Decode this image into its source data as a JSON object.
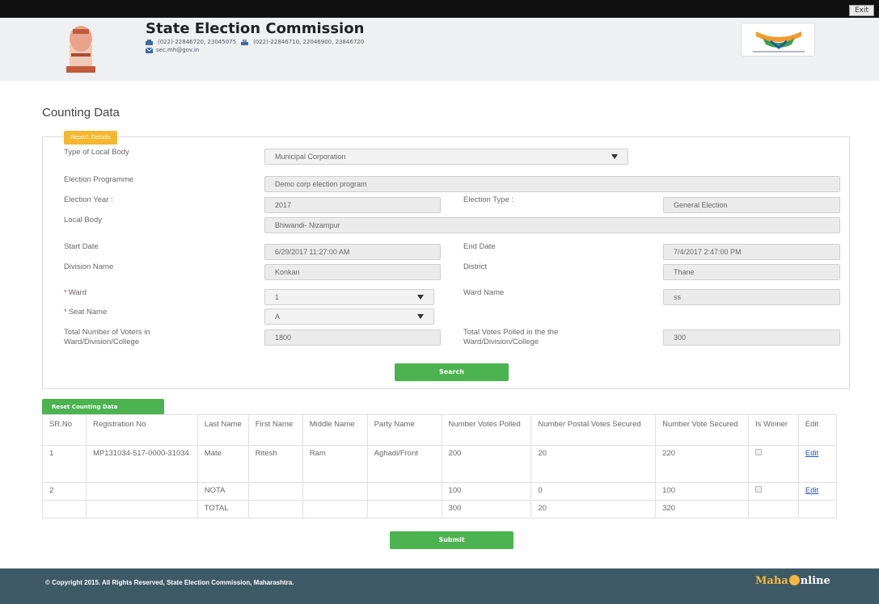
{
  "topbar": {
    "exit_label": "Exit"
  },
  "header": {
    "title": "State Election Commission",
    "phone": "(022)-22846720, 23045075",
    "fax": "(022)-22846710, 22046900, 23846720",
    "email": "sec.mh@gov.in"
  },
  "page": {
    "title": "Counting Data"
  },
  "report": {
    "badge": "Report Details",
    "type_label": "Type of Local Body",
    "type_value": "Municipal Corporation",
    "programme_label": "Election Programme",
    "programme_value": "Demo corp election program",
    "year_label": "Election Year :",
    "year_value": "2017",
    "etype_label": "Election Type :",
    "etype_value": "General Election",
    "body_label": "Local Body",
    "body_value": "Bhiwandi- Nizampur",
    "start_label": "Start Date",
    "start_value": "6/29/2017 11:27:00 AM",
    "end_label": "End Date",
    "end_value": "7/4/2017 2:47:00 PM",
    "division_label": "Division Name",
    "division_value": "Konkan",
    "district_label": "District",
    "district_value": "Thane",
    "ward_label": "Ward",
    "ward_value": "1",
    "wardname_label": "Ward Name",
    "wardname_value": "ss",
    "seat_label": "Seat Name",
    "seat_value": "A",
    "voters_label": "Total Number of Voters in Ward/Division/College",
    "voters_value": "1800",
    "polled_label": "Total Votes Polled in the the Ward/Division/College",
    "polled_value": "300",
    "search_label": "Search"
  },
  "table": {
    "reset_label": "Reset Counting Data",
    "headers": [
      "SR.No",
      "Registration No",
      "Last Name",
      "First Name",
      "Middle Name",
      "Party Name",
      "Number Votes Polled",
      "Number Postal Votes Secured",
      "Number Vote Secured",
      "Is Winner",
      "Edit"
    ],
    "rows": [
      [
        "1",
        "MP131034-517-0000-31034",
        "Mate",
        "Ritesh",
        "Ram",
        "Aghadi/Front",
        "200",
        "20",
        "220",
        "",
        "Edit"
      ],
      [
        "2",
        "",
        "NOTA",
        "",
        "",
        "",
        "100",
        "0",
        "100",
        "",
        "Edit"
      ],
      [
        "",
        "",
        "TOTAL",
        "",
        "",
        "",
        "300",
        "20",
        "320",
        "",
        ""
      ]
    ],
    "submit_label": "Submit"
  },
  "footer": {
    "copyright": "© Copyright 2015. All Rights Reserved, State Election Commission, Maharashtra.",
    "brand_left": "Maha",
    "brand_right": "nline"
  },
  "colors": {
    "accent_green": "#4bb34f",
    "badge_orange": "#f6b730",
    "footer_bg": "#3f5a67",
    "link_blue": "#2255cc"
  }
}
